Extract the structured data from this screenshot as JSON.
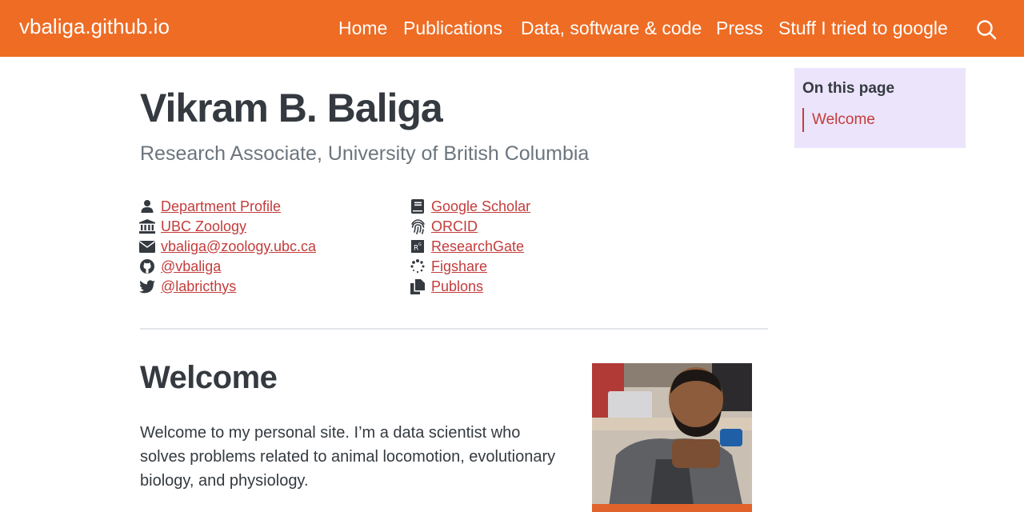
{
  "navbar": {
    "brand": "vbaliga.github.io",
    "items": [
      "Home",
      "Publications",
      "Data, software & code",
      "Press",
      "Stuff I tried to google"
    ],
    "search_icon": "search-icon"
  },
  "header": {
    "name": "Vikram B. Baliga",
    "subtitle": "Research Associate, University of British Columbia"
  },
  "links": {
    "left": [
      {
        "icon": "user-icon",
        "label": "Department Profile"
      },
      {
        "icon": "university-icon",
        "label": "UBC Zoology"
      },
      {
        "icon": "envelope-icon",
        "label": "vbaliga@zoology.ubc.ca"
      },
      {
        "icon": "github-icon",
        "label": "@vbaliga"
      },
      {
        "icon": "twitter-icon",
        "label": "@labricthys"
      }
    ],
    "right": [
      {
        "icon": "book-icon",
        "label": "Google Scholar"
      },
      {
        "icon": "fingerprint-icon",
        "label": "ORCID"
      },
      {
        "icon": "researchgate-icon",
        "label": "ResearchGate"
      },
      {
        "icon": "figshare-icon",
        "label": "Figshare"
      },
      {
        "icon": "copy-icon",
        "label": "Publons"
      }
    ]
  },
  "welcome": {
    "heading": "Welcome",
    "text": "Welcome to my personal site. I’m a data scientist who solves problems related to animal locomotion, evolutionary biology, and physiology."
  },
  "toc": {
    "title": "On this page",
    "items": [
      "Welcome"
    ]
  },
  "colors": {
    "navbar": "#ee6c24",
    "link": "#c33c3c",
    "toc_background": "#ece4fa",
    "text": "#343a40",
    "muted": "#6c757d"
  }
}
